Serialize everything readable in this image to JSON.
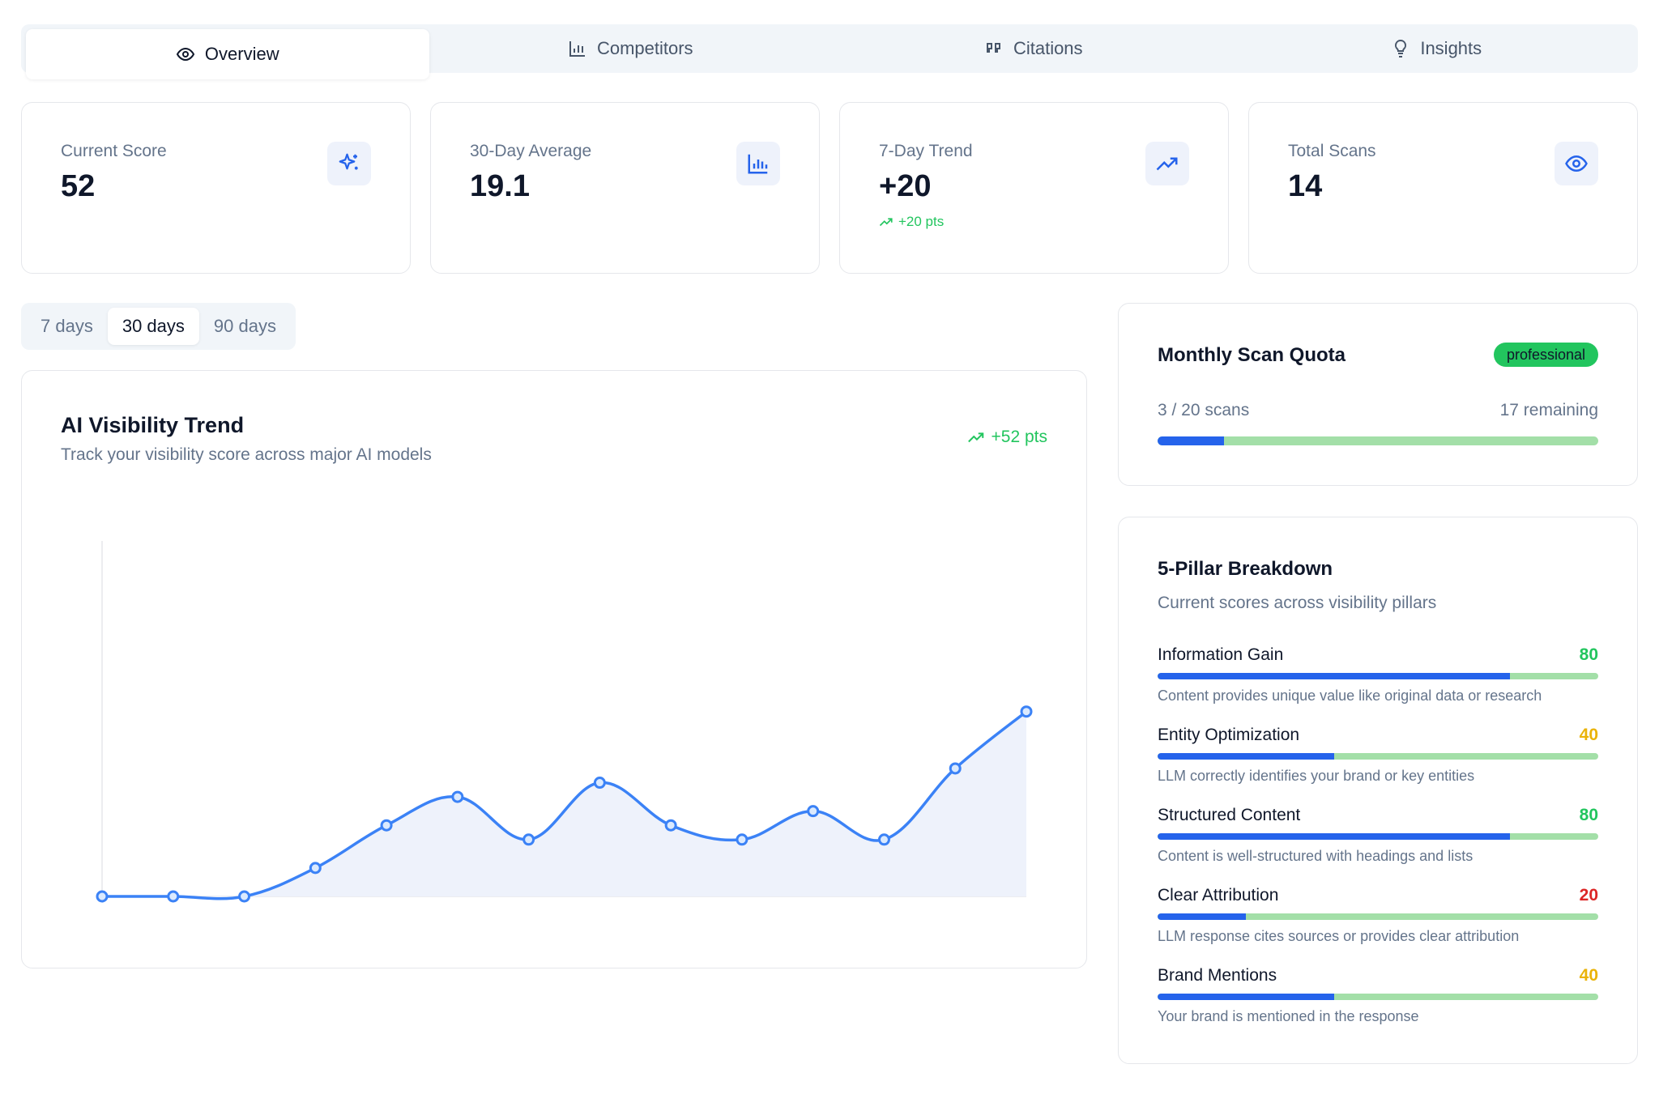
{
  "tabs": [
    {
      "label": "Overview",
      "icon": "eye-icon",
      "active": true
    },
    {
      "label": "Competitors",
      "icon": "bar-chart-icon",
      "active": false
    },
    {
      "label": "Citations",
      "icon": "quote-icon",
      "active": false
    },
    {
      "label": "Insights",
      "icon": "lightbulb-icon",
      "active": false
    }
  ],
  "stats": [
    {
      "label": "Current Score",
      "value": "52",
      "icon": "sparkles-icon"
    },
    {
      "label": "30-Day Average",
      "value": "19.1",
      "icon": "bar-chart-icon"
    },
    {
      "label": "7-Day Trend",
      "value": "+20",
      "sub": "+20 pts",
      "icon": "trending-up-icon"
    },
    {
      "label": "Total Scans",
      "value": "14",
      "icon": "eye-icon"
    }
  ],
  "range": {
    "options": [
      "7 days",
      "30 days",
      "90 days"
    ],
    "selected": "30 days"
  },
  "trend": {
    "title": "AI Visibility Trend",
    "subtitle": "Track your visibility score across major AI models",
    "delta": "+52 pts"
  },
  "chart_data": {
    "type": "area",
    "x": [
      1,
      2,
      3,
      4,
      5,
      6,
      7,
      8,
      9,
      10,
      11,
      12,
      13,
      14
    ],
    "values": [
      0,
      0,
      0,
      4,
      10,
      14,
      8,
      16,
      10,
      8,
      12,
      8,
      18,
      26
    ],
    "ylim": [
      0,
      50
    ],
    "grid": false,
    "color": "#3b82f6",
    "fill": "#eef2fb"
  },
  "quota": {
    "title": "Monthly Scan Quota",
    "badge": "professional",
    "used_text": "3 / 20 scans",
    "remaining_text": "17 remaining",
    "used_fraction": 0.15
  },
  "pillars": {
    "title": "5-Pillar Breakdown",
    "subtitle": "Current scores across visibility pillars",
    "items": [
      {
        "name": "Information Gain",
        "score": "80",
        "value": 80,
        "color": "#22c55e",
        "desc": "Content provides unique value like original data or research"
      },
      {
        "name": "Entity Optimization",
        "score": "40",
        "value": 40,
        "color": "#eab308",
        "desc": "LLM correctly identifies your brand or key entities"
      },
      {
        "name": "Structured Content",
        "score": "80",
        "value": 80,
        "color": "#22c55e",
        "desc": "Content is well-structured with headings and lists"
      },
      {
        "name": "Clear Attribution",
        "score": "20",
        "value": 20,
        "color": "#dc2626",
        "desc": "LLM response cites sources or provides clear attribution"
      },
      {
        "name": "Brand Mentions",
        "score": "40",
        "value": 40,
        "color": "#eab308",
        "desc": "Your brand is mentioned in the response"
      }
    ]
  },
  "colors": {
    "accent": "#2563eb",
    "positive": "#22c55e"
  }
}
